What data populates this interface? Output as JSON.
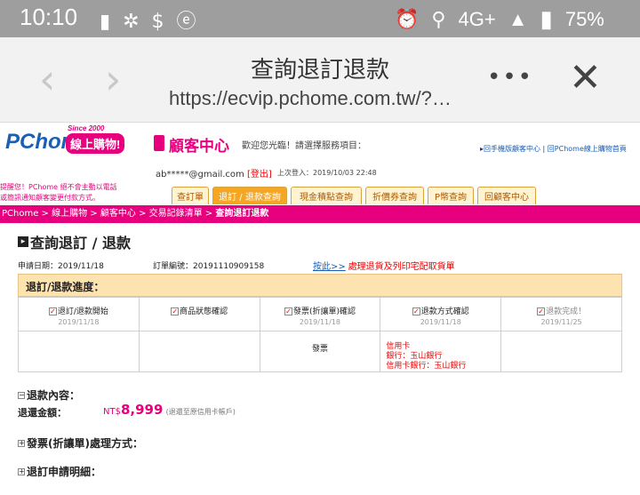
{
  "status_bar": {
    "time": "10:10",
    "icons": [
      "shopping-bag-icon",
      "fan-icon",
      "dollar-icon",
      "e-icon"
    ],
    "network": "4G+",
    "battery": "75%"
  },
  "browser": {
    "title": "查詢退訂退款",
    "url": "https://ecvip.pchome.com.tw/?…",
    "menu": "•••"
  },
  "header": {
    "logo_text": "PChome",
    "logo_sub": "線上購物!",
    "logo_since": "Since 2000",
    "cs_title": "顧客中心",
    "welcome": "歡迎您光臨！請選擇服務項目：",
    "link_mobile": "回手機版顧客中心",
    "link_home": "回PChome線上購物首頁",
    "email": "ab*****@gmail.com",
    "logout": "[登出]",
    "last_login": "上次登入：2019/10/03 22:48",
    "warning_line1": "提醒您！PChome 絕不會主動以電話",
    "warning_line2": "或簡訊通知顧客變更付款方式。"
  },
  "tabs": [
    {
      "label": "查訂單",
      "active": false
    },
    {
      "label": "退訂 / 退款查詢",
      "active": true
    },
    {
      "label": "現金積點查詢",
      "active": false
    },
    {
      "label": "折價券查詢",
      "active": false
    },
    {
      "label": "P幣查詢",
      "active": false
    },
    {
      "label": "回顧客中心",
      "active": false
    }
  ],
  "breadcrumb": {
    "items": [
      "PChome",
      "線上購物",
      "顧客中心",
      "交易記錄清單"
    ],
    "separator": " > ",
    "current": "查詢退訂退款"
  },
  "page": {
    "title": "查詢退訂 / 退款",
    "apply_date": "申請日期：2019/11/18",
    "order_no": "訂單編號：20191110909158",
    "link_here": "按此>>",
    "link_desc": "處理退貨及列印宅配取貨單"
  },
  "progress": {
    "heading": "退訂/退款進度：",
    "steps": [
      {
        "label": "退訂/退款開始",
        "date": "2019/11/18",
        "checked": true
      },
      {
        "label": "商品狀態確認",
        "date": "",
        "checked": true
      },
      {
        "label": "發票(折讓單)確認",
        "date": "2019/11/18",
        "checked": true
      },
      {
        "label": "退款方式確認",
        "date": "2019/11/18",
        "checked": true
      },
      {
        "label": "退款完成！",
        "date": "2019/11/25",
        "checked": true
      }
    ],
    "invoice_cell": "發票",
    "refund_lines": [
      "信用卡",
      "銀行：玉山銀行",
      "信用卡銀行：玉山銀行"
    ]
  },
  "sections": {
    "refund_content": "退款內容：",
    "refund_amount_label": "退還金額：",
    "currency": "NT$",
    "amount": "8,999",
    "amount_note": "(退還至原信用卡帳戶)",
    "invoice_method": "發票(折讓單)處理方式：",
    "cancel_detail": "退訂申請明細："
  },
  "colors": {
    "brand_pink": "#e6007e",
    "brand_blue": "#1a5fb4",
    "tab_orange": "#f5a623",
    "progress_bg": "#fde3b0"
  }
}
